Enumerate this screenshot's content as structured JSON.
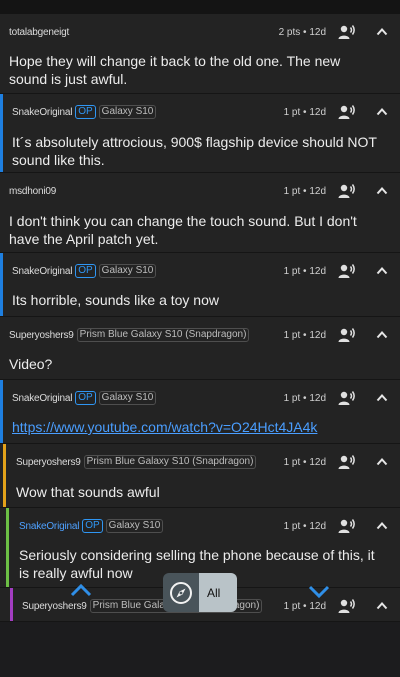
{
  "comments": [
    {
      "author": "totalabgeneigt",
      "op": false,
      "flair": "",
      "points": "2 pts • 12d",
      "text": "Hope they will change it back to the old one. The new sound is just awful.",
      "link": false,
      "bar": ""
    },
    {
      "author": "SnakeOriginal",
      "op": true,
      "op_label": "OP",
      "flair": "Galaxy S10",
      "points": "1 pt • 12d",
      "text": "It´s absolutely attrocious, 900$ flagship device should NOT sound like this.",
      "link": false,
      "bar": "#1e7fe0"
    },
    {
      "author": "msdhoni09",
      "op": false,
      "flair": "",
      "points": "1 pt • 12d",
      "text": "I don't think you can change the touch sound. But I don't have the April patch yet.",
      "link": false,
      "bar": ""
    },
    {
      "author": "SnakeOriginal",
      "op": true,
      "op_label": "OP",
      "flair": "Galaxy S10",
      "points": "1 pt • 12d",
      "text": "Its horrible, sounds like a toy now",
      "link": false,
      "bar": "#1e7fe0"
    },
    {
      "author": "Superyoshers9",
      "op": false,
      "flair": "Prism Blue Galaxy S10 (Snapdragon)",
      "points": "1 pt • 12d",
      "text": "Video?",
      "link": false,
      "bar": ""
    },
    {
      "author": "SnakeOriginal",
      "op": true,
      "op_label": "OP",
      "flair": "Galaxy S10",
      "points": "1 pt • 12d",
      "text": "https://www.youtube.com/watch?v=O24Hct4JA4k",
      "link": true,
      "bar": "#1e7fe0"
    },
    {
      "author": "Superyoshers9",
      "op": false,
      "flair": "Prism Blue Galaxy S10 (Snapdragon)",
      "points": "1 pt • 12d",
      "text": "Wow that sounds awful",
      "link": false,
      "bar": "#e3a21a"
    },
    {
      "author": "SnakeOriginal",
      "op": true,
      "op_label": "OP",
      "flair": "Galaxy S10",
      "points": "1 pt • 12d",
      "text": "Seriously considering selling the phone because of this, it is really awful now",
      "link": false,
      "bar": "#6cbf45",
      "author_link": true
    },
    {
      "author": "Superyoshers9",
      "op": false,
      "flair": "Prism Blue Galaxy S10 (Snapdragon)",
      "points": "1 pt • 12d",
      "text": "",
      "link": false,
      "bar": "#a23dc1"
    }
  ],
  "navigator": {
    "label": "All",
    "compass_icon": "compass-icon",
    "up_icon": "chevron-up-icon",
    "down_icon": "chevron-down-icon"
  },
  "colors": {
    "accent": "#2f96f3",
    "background": "#232323"
  }
}
